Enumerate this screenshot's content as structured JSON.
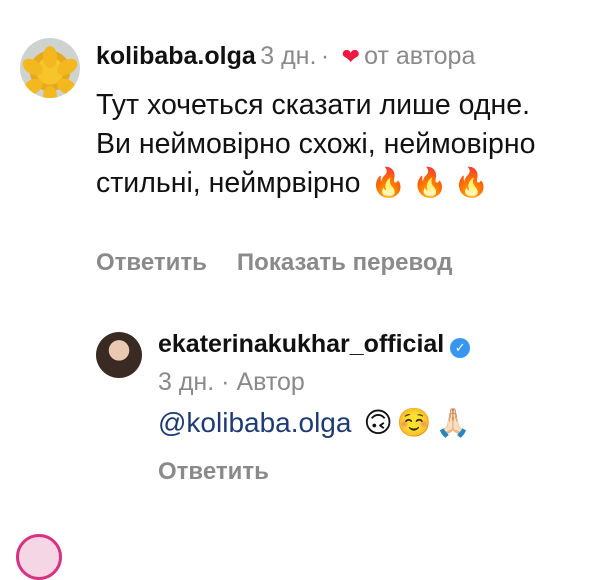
{
  "comment1": {
    "username": "kolibaba.olga",
    "time": "3 дн.",
    "dot": "·",
    "liked_by_author": "от автора",
    "text": "Тут хочеться сказати лише одне. Ви неймовірно схожі, неймовірно стильні, неймрвірно",
    "emojis": "🔥🔥🔥",
    "reply_label": "Ответить",
    "translate_label": "Показать перевод"
  },
  "comment2": {
    "username": "ekaterinakukhar_official",
    "verified_icon": "✓",
    "time": "3 дн.",
    "dot": "·",
    "author_badge": "Автор",
    "mention": "@kolibaba.olga",
    "emojis": "🙃☺️🙏🏻",
    "reply_label": "Ответить"
  },
  "colors": {
    "heart": "#ef1a3f",
    "muted": "#8a8a8a",
    "mention": "#1f3b73",
    "verified": "#3797f0"
  }
}
